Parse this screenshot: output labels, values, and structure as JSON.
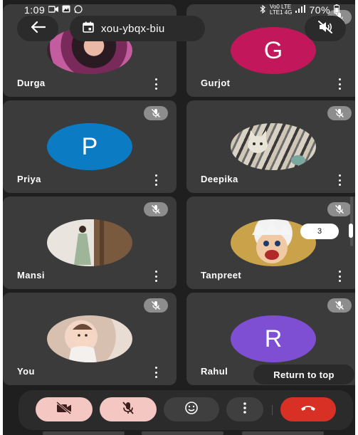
{
  "status_bar": {
    "time": "1:09",
    "left_icons": [
      "video-camera-icon",
      "photo-icon",
      "whatsapp-icon"
    ],
    "right_icons": [
      "bluetooth-icon",
      "volte-icon",
      "signal-icon"
    ],
    "network_top": "Vo0 LTE",
    "network_bottom": "LTE1 4G",
    "battery": "70%"
  },
  "header": {
    "meeting_code": "xou-ybqx-biu",
    "back_icon": "arrow-left-icon",
    "calendar_icon": "calendar-icon",
    "speaker_icon": "speaker-off-icon"
  },
  "participants": [
    {
      "name": "Durga",
      "avatar_type": "photo",
      "photo_desc": "portrait-dark",
      "muted": false
    },
    {
      "name": "Gurjot",
      "avatar_type": "letter",
      "letter": "G",
      "color": "#c2185b",
      "muted": true
    },
    {
      "name": "Priya",
      "avatar_type": "letter",
      "letter": "P",
      "color": "#0b7cc4",
      "muted": true
    },
    {
      "name": "Deepika",
      "avatar_type": "photo",
      "photo_desc": "cat",
      "muted": true
    },
    {
      "name": "Mansi",
      "avatar_type": "photo",
      "photo_desc": "standing-person",
      "muted": true
    },
    {
      "name": "Tanpreet",
      "avatar_type": "photo",
      "photo_desc": "anime-face",
      "muted": true
    },
    {
      "name": "You",
      "avatar_type": "photo",
      "photo_desc": "baby",
      "muted": true
    },
    {
      "name": "Rahul",
      "avatar_type": "letter",
      "letter": "R",
      "color": "#7e4fd3",
      "muted": true
    }
  ],
  "scroll_indicator": {
    "count": "3"
  },
  "return_to_top_label": "Return to top",
  "controls": {
    "camera_icon": "camera-off-icon",
    "mic_icon": "mic-off-icon",
    "reactions_icon": "emoji-icon",
    "more_icon": "more-vert-icon",
    "end_call_icon": "end-call-icon",
    "colors": {
      "off_state": "#f4c7c3",
      "end_call": "#d93025"
    }
  }
}
